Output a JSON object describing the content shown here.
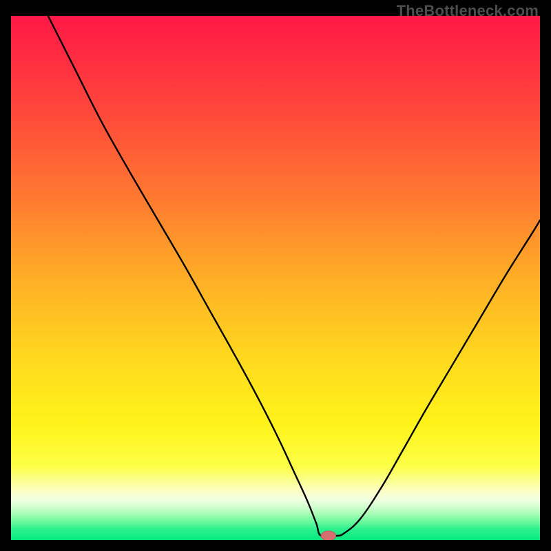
{
  "watermark": "TheBottleneck.com",
  "colors": {
    "black": "#000000",
    "curve": "#000000",
    "marker_fill": "#d6706f",
    "marker_stroke": "#c45a58"
  },
  "chart_data": {
    "type": "line",
    "title": "",
    "xlabel": "",
    "ylabel": "",
    "xlim": [
      0,
      100
    ],
    "ylim": [
      0,
      100
    ],
    "grid": false,
    "legend_position": "none",
    "gradient_stops": [
      {
        "offset": 0.0,
        "color": "#ff1945"
      },
      {
        "offset": 0.1,
        "color": "#ff3140"
      },
      {
        "offset": 0.22,
        "color": "#ff5338"
      },
      {
        "offset": 0.35,
        "color": "#ff7a30"
      },
      {
        "offset": 0.5,
        "color": "#ffae26"
      },
      {
        "offset": 0.65,
        "color": "#ffd81e"
      },
      {
        "offset": 0.78,
        "color": "#fff41a"
      },
      {
        "offset": 0.86,
        "color": "#fcff47"
      },
      {
        "offset": 0.905,
        "color": "#fbffc1"
      },
      {
        "offset": 0.922,
        "color": "#f2ffe0"
      },
      {
        "offset": 0.935,
        "color": "#d7ffd3"
      },
      {
        "offset": 0.95,
        "color": "#a8feb6"
      },
      {
        "offset": 0.965,
        "color": "#6cf99e"
      },
      {
        "offset": 0.98,
        "color": "#2bf18e"
      },
      {
        "offset": 1.0,
        "color": "#04e97f"
      }
    ],
    "series": [
      {
        "name": "bottleneck-curve",
        "x": [
          7.0,
          12.0,
          17.0,
          22.0,
          27.5,
          33.0,
          38.0,
          43.0,
          47.0,
          50.5,
          53.5,
          56.0,
          57.7,
          58.6,
          61.5,
          63.0,
          66.0,
          70.0,
          74.0,
          78.5,
          83.5,
          88.5,
          93.5,
          98.5,
          100.0
        ],
        "y": [
          100.0,
          90.0,
          80.0,
          71.0,
          61.5,
          52.0,
          43.0,
          34.0,
          26.5,
          19.5,
          13.0,
          7.5,
          3.2,
          0.8,
          0.8,
          1.3,
          4.0,
          10.0,
          17.0,
          25.0,
          33.5,
          42.0,
          50.5,
          58.5,
          61.0
        ]
      }
    ],
    "marker": {
      "x": 60.0,
      "y": 0.8,
      "rx": 1.4,
      "ry": 0.9
    }
  }
}
